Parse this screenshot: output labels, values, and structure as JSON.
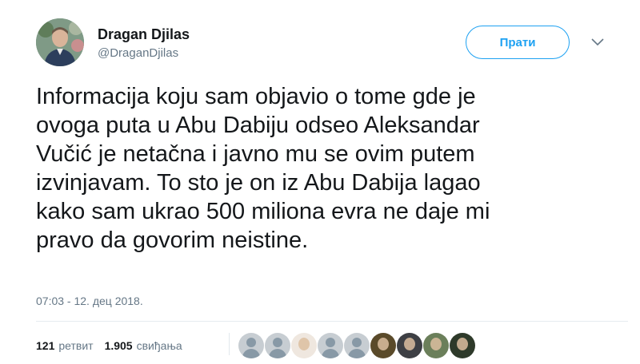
{
  "user": {
    "display_name": "Dragan Djilas",
    "handle": "@DraganDjilas"
  },
  "follow_button": {
    "label": "Прати"
  },
  "tweet": {
    "text": "Informacija koju sam objavio o tome gde je\novoga puta u Abu Dabiju odseo Aleksandar\nVučić je netačna i javno mu se ovim putem\nizvinjavam. To sto je on iz Abu Dabija lagao\nkako sam ukrao 500 miliona evra ne daje mi\npravo da govorim neistine.",
    "timestamp": "07:03 - 12. дец 2018."
  },
  "stats": {
    "retweets_count": "121",
    "retweets_label": "ретвит",
    "likes_count": "1.905",
    "likes_label": "свиђања"
  },
  "likers": [
    {
      "type": "default"
    },
    {
      "type": "default"
    },
    {
      "type": "photo",
      "color": "#efe7df"
    },
    {
      "type": "default"
    },
    {
      "type": "default"
    },
    {
      "type": "photo",
      "color": "#5a4a2a"
    },
    {
      "type": "photo",
      "color": "#3d3f44"
    },
    {
      "type": "photo",
      "color": "#6b7f5a"
    },
    {
      "type": "photo",
      "color": "#2e3a2a"
    }
  ],
  "colors": {
    "accent": "#1da1f2",
    "secondary_text": "#657786",
    "primary_text": "#14171a"
  }
}
